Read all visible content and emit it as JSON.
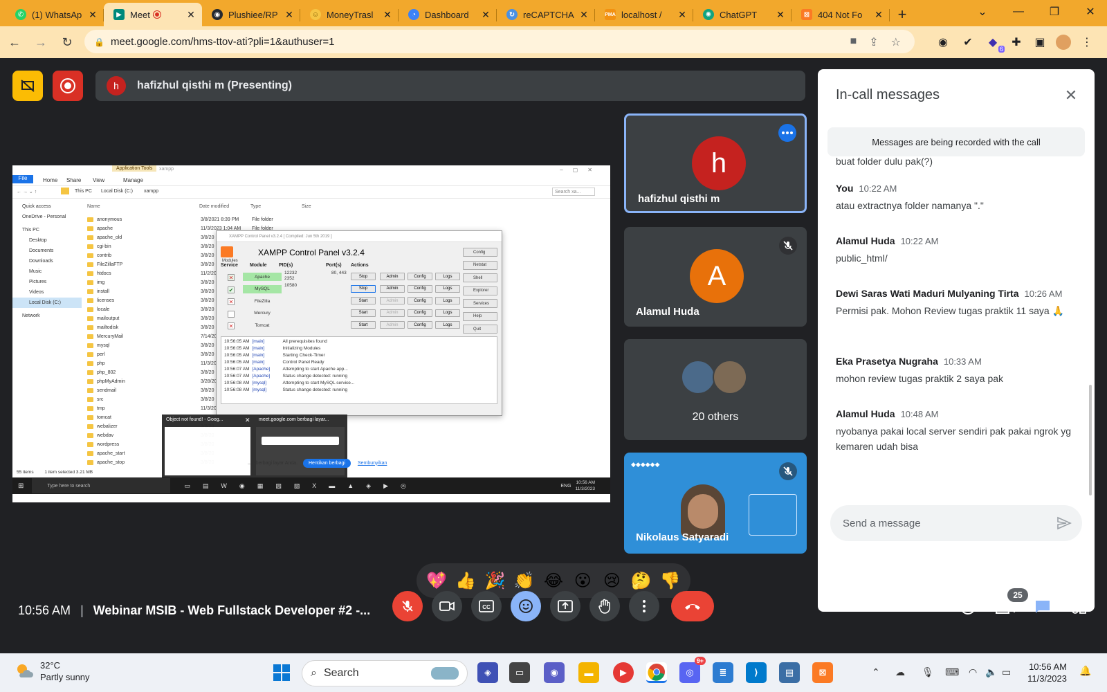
{
  "browser": {
    "tabs": [
      {
        "label": "(1) WhatsAp",
        "icon": "whatsapp-icon",
        "color": "#25d366"
      },
      {
        "label": "Meet - ",
        "icon": "meet-icon",
        "color": "#00897b",
        "active": true,
        "recording": true
      },
      {
        "label": "Plushiee/RP",
        "icon": "github-icon",
        "color": "#24292f"
      },
      {
        "label": "MoneyTrasl",
        "icon": "smiley-icon",
        "color": "#f6c544"
      },
      {
        "label": "Dashboard",
        "icon": "dashboard-icon",
        "color": "#3b82f6"
      },
      {
        "label": "reCAPTCHA",
        "icon": "recaptcha-icon",
        "color": "#4a90e2"
      },
      {
        "label": "localhost /",
        "icon": "phpmyadmin-icon",
        "color": "#f29111"
      },
      {
        "label": "ChatGPT",
        "icon": "chatgpt-icon",
        "color": "#10a37f"
      },
      {
        "label": "404 Not Fo",
        "icon": "xampp-icon",
        "color": "#fb7a24"
      }
    ],
    "url": "meet.google.com/hms-ttov-ati?pli=1&authuser=1",
    "extension_badge": "6"
  },
  "meet": {
    "presenter_initial": "h",
    "presenting_label": "hafizhul qisthi m (Presenting)",
    "participants": [
      {
        "name": "hafizhul qisthi m",
        "initial": "h",
        "color": "#c5221f",
        "selected": true
      },
      {
        "name": "Alamul Huda",
        "initial": "A",
        "color": "#e8710a",
        "muted": true
      },
      {
        "name": "20 others"
      },
      {
        "name": "Nikolaus Satyaradi",
        "muted": true,
        "video": true
      }
    ],
    "clock": "10:56 AM",
    "meeting_title": "Webinar MSIB - Web Fullstack Developer #2 -...",
    "people_count": "25",
    "reactions": [
      "💖",
      "👍",
      "🎉",
      "👏",
      "😂",
      "😮",
      "😢",
      "🤔",
      "👎"
    ]
  },
  "chat": {
    "title": "In-call messages",
    "notice": "Messages are being recorded with the call",
    "partial_text": "buat folder dulu pak(?)",
    "messages": [
      {
        "sender": "You",
        "time": "10:22 AM",
        "text": "atau extractnya folder namanya \".\""
      },
      {
        "sender": "Alamul Huda",
        "time": "10:22 AM",
        "text": "public_html/"
      },
      {
        "sender": "Dewi Saras Wati Maduri Mulyaning Tirta",
        "time": "10:26 AM",
        "text": "Permisi pak. Mohon Review tugas praktik 11 saya 🙏"
      },
      {
        "sender": "Eka Prasetya Nugraha",
        "time": "10:33 AM",
        "text": "mohon review tugas praktik 2 saya pak"
      },
      {
        "sender": "Alamul Huda",
        "time": "10:48 AM",
        "text": "nyobanya pakai local server sendiri pak pakai ngrok yg kemaren udah bisa"
      }
    ],
    "input_placeholder": "Send a message"
  },
  "shared_screen": {
    "explorer": {
      "ribbon_context": "Application Tools",
      "window_title": "xampp",
      "ribbon_tabs": [
        "File",
        "Home",
        "Share",
        "View",
        "Manage"
      ],
      "path": [
        "This PC",
        "Local Disk (C:)",
        "xampp"
      ],
      "search_placeholder": "Search xa...",
      "nav": [
        "Quick access",
        "OneDrive - Personal",
        "This PC",
        "Desktop",
        "Documents",
        "Downloads",
        "Music",
        "Pictures",
        "Videos",
        "Local Disk (C:)",
        "Network"
      ],
      "columns": [
        "Name",
        "Date modified",
        "Type",
        "Size"
      ],
      "items": [
        "anonymous",
        "apache",
        "apache_old",
        "cgi-bin",
        "contrib",
        "FileZillaFTP",
        "htdocs",
        "img",
        "install",
        "licenses",
        "locale",
        "mailoutput",
        "mailtodisk",
        "MercuryMail",
        "mysql",
        "perl",
        "php",
        "php_802",
        "phpMyAdmin",
        "sendmail",
        "src",
        "tmp",
        "tomcat",
        "webalizer",
        "webdav",
        "wordpress",
        "apache_start",
        "apache_stop"
      ],
      "dates": [
        "3/8/2021 8:39 PM",
        "11/3/2023 1:04 AM",
        "3/8/20",
        "3/8/20",
        "3/8/20",
        "3/8/20",
        "11/2/20",
        "3/8/20",
        "3/8/20",
        "3/8/20",
        "3/8/20",
        "3/8/20",
        "3/8/20",
        "7/14/20",
        "3/8/20",
        "3/8/20",
        "11/3/20",
        "3/8/20",
        "3/28/20",
        "3/8/20",
        "3/8/20",
        "11/3/20",
        "3/8/20",
        "3/8/20",
        "3/8/20",
        "3/8/20",
        "3/8/20",
        "3/8/20"
      ],
      "types": [
        "File folder",
        "File folder"
      ],
      "status_count": "55 items",
      "status_selected": "1 item selected  3.21 MB"
    },
    "xampp": {
      "window_title": "XAMPP Control Panel v3.2.4   [ Compiled: Jun 5th 2019 ]",
      "heading": "XAMPP Control Panel v3.2.4",
      "modules_label": "Modules",
      "columns": [
        "Service",
        "Module",
        "PID(s)",
        "Port(s)",
        "Actions"
      ],
      "rows": [
        {
          "module": "Apache",
          "pids": "12232\n2352",
          "ports": "80, 443",
          "action": "Stop",
          "running": true
        },
        {
          "module": "MySQL",
          "pids": "10580",
          "ports": "",
          "action": "Stop",
          "running": true
        },
        {
          "module": "FileZilla",
          "pids": "",
          "ports": "",
          "action": "Start",
          "running": false
        },
        {
          "module": "Mercury",
          "pids": "",
          "ports": "",
          "action": "Start",
          "running": false
        },
        {
          "module": "Tomcat",
          "pids": "",
          "ports": "",
          "action": "Start",
          "running": false
        }
      ],
      "row_buttons": [
        "Admin",
        "Config",
        "Logs"
      ],
      "side_buttons": [
        "Config",
        "Netstat",
        "Shell",
        "Explorer",
        "Services",
        "Help",
        "Quit"
      ],
      "log": [
        {
          "time": "10:56:05 AM",
          "tag": "[main]",
          "msg": "All prerequisites found"
        },
        {
          "time": "10:56:05 AM",
          "tag": "[main]",
          "msg": "Initializing Modules"
        },
        {
          "time": "10:56:05 AM",
          "tag": "[main]",
          "msg": "Starting Check-Timer"
        },
        {
          "time": "10:56:05 AM",
          "tag": "[main]",
          "msg": "Control Panel Ready"
        },
        {
          "time": "10:56:07 AM",
          "tag": "[Apache]",
          "msg": "Attempting to start Apache app..."
        },
        {
          "time": "10:56:07 AM",
          "tag": "[Apache]",
          "msg": "Status change detected: running"
        },
        {
          "time": "10:56:08 AM",
          "tag": "[mysql]",
          "msg": "Attempting to start MySQL service..."
        },
        {
          "time": "10:56:08 AM",
          "tag": "[mysql]",
          "msg": "Status change detected: running"
        }
      ]
    },
    "thumbnails": [
      "Object not found! - Goog...",
      "meet.google.com berbagi layar..."
    ],
    "share_bar": {
      "text": "...n berbagi layar Anda.",
      "stop": "Hentikan berbagi",
      "hide": "Sembunyikan"
    },
    "taskbar": {
      "search": "Type here to search",
      "time": "10:56 AM",
      "date": "11/3/2023",
      "lang": "ENG"
    }
  },
  "windows": {
    "weather_temp": "32°C",
    "weather_desc": "Partly sunny",
    "search": "Search",
    "time": "10:56 AM",
    "date": "11/3/2023",
    "discord_badge": "9+"
  }
}
